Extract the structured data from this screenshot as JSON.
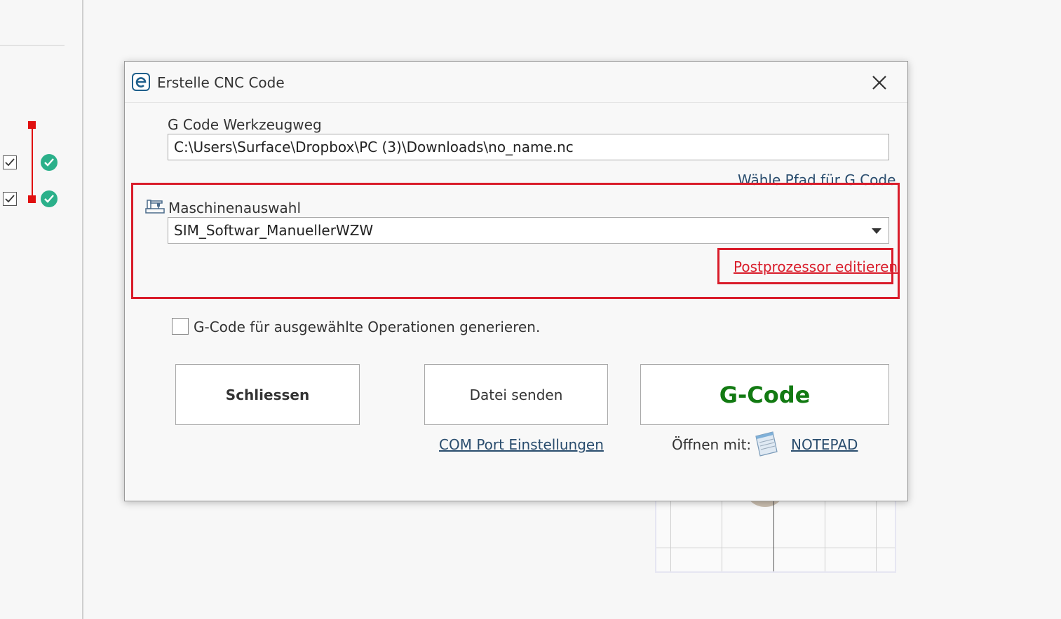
{
  "dialog": {
    "title": "Erstelle CNC Code",
    "gcode_path": {
      "label": "G Code Werkzeugweg",
      "value": "C:\\Users\\Surface\\Dropbox\\PC (3)\\Downloads\\no_name.nc",
      "choose_link": "Wähle Pfad für G Code"
    },
    "machine": {
      "label": "Maschinenauswahl",
      "selected": "SIM_Softwar_ManuellerWZW",
      "postprocessor_link": "Postprozessor editieren"
    },
    "selected_ops_checkbox": {
      "label": "G-Code für ausgewählte Operationen generieren.",
      "checked": false
    },
    "buttons": {
      "close": "Schliessen",
      "send_file": "Datei senden",
      "gcode": "G-Code"
    },
    "com_port_link": "COM Port Einstellungen",
    "open_with": {
      "label": "Öffnen mit:",
      "app": "NOTEPAD"
    }
  },
  "colors": {
    "highlight": "#d91c2a",
    "gcode_green": "#127a12",
    "link_red": "#d91c2a",
    "link_blue": "#2a4d6e",
    "status_ok": "#2bb08a"
  }
}
